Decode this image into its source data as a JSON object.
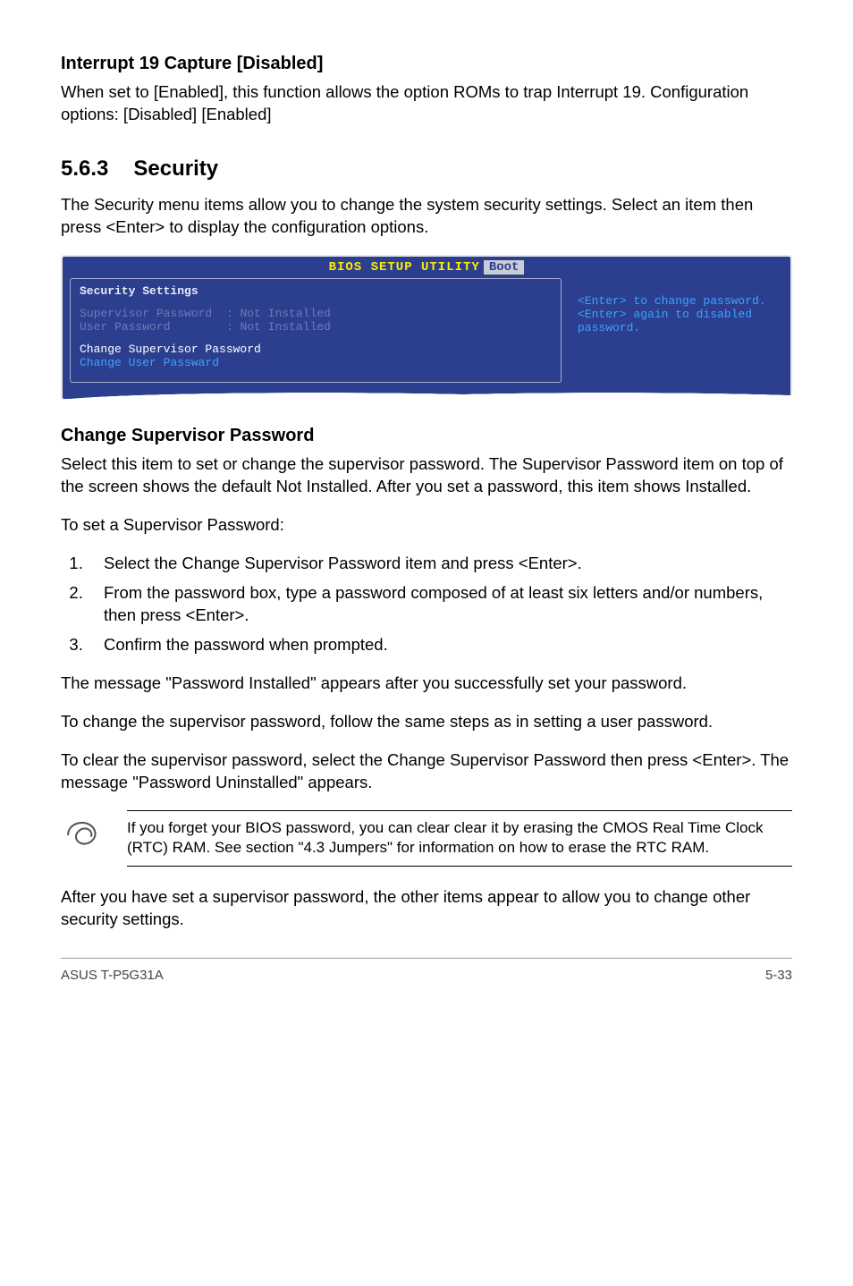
{
  "sec1": {
    "heading": "Interrupt 19 Capture [Disabled]",
    "body": "When set to [Enabled], this function allows the option ROMs to trap Interrupt 19. Configuration options: [Disabled] [Enabled]"
  },
  "sec2": {
    "num": "5.6.3",
    "title": "Security",
    "intro": "The Security menu items allow you to change the system security settings. Select an item then press <Enter> to display the configuration options."
  },
  "bios": {
    "title": "BIOS SETUP UTILITY",
    "tab": "Boot",
    "panel_heading": "Security Settings",
    "row1_label": "Supervisor Password",
    "row1_value": ": Not Installed",
    "row2_label": "User Password",
    "row2_value": ": Not Installed",
    "sel": "Change Supervisor Password",
    "link": "Change User Passward",
    "help": "<Enter> to change password.\n<Enter> again to disabled password."
  },
  "sec3": {
    "heading": "Change Supervisor Password",
    "p1": "Select this item to set or change the supervisor password. The Supervisor Password item on top of the screen shows the default Not Installed. After you set a password, this item shows Installed.",
    "p2": "To set a Supervisor Password:",
    "steps": [
      "Select the Change Supervisor Password item and press <Enter>.",
      "From the password box, type a password composed of at least six letters and/or numbers, then press <Enter>.",
      "Confirm the password when prompted."
    ],
    "p3": "The message \"Password Installed\" appears after you successfully set your password.",
    "p4": "To change the supervisor password, follow the same steps as in setting a user password.",
    "p5": "To clear the supervisor password, select the Change Supervisor Password then press <Enter>. The message \"Password Uninstalled\" appears."
  },
  "note": {
    "text": "If you forget your BIOS password, you can clear clear it by erasing the CMOS Real Time Clock (RTC) RAM. See section \"4.3  Jumpers\" for information on how to erase the RTC RAM."
  },
  "sec4": {
    "p": "After you have set a supervisor password, the other items appear to allow you to change other security settings."
  },
  "footer": {
    "left": "ASUS T-P5G31A",
    "right": "5-33"
  }
}
